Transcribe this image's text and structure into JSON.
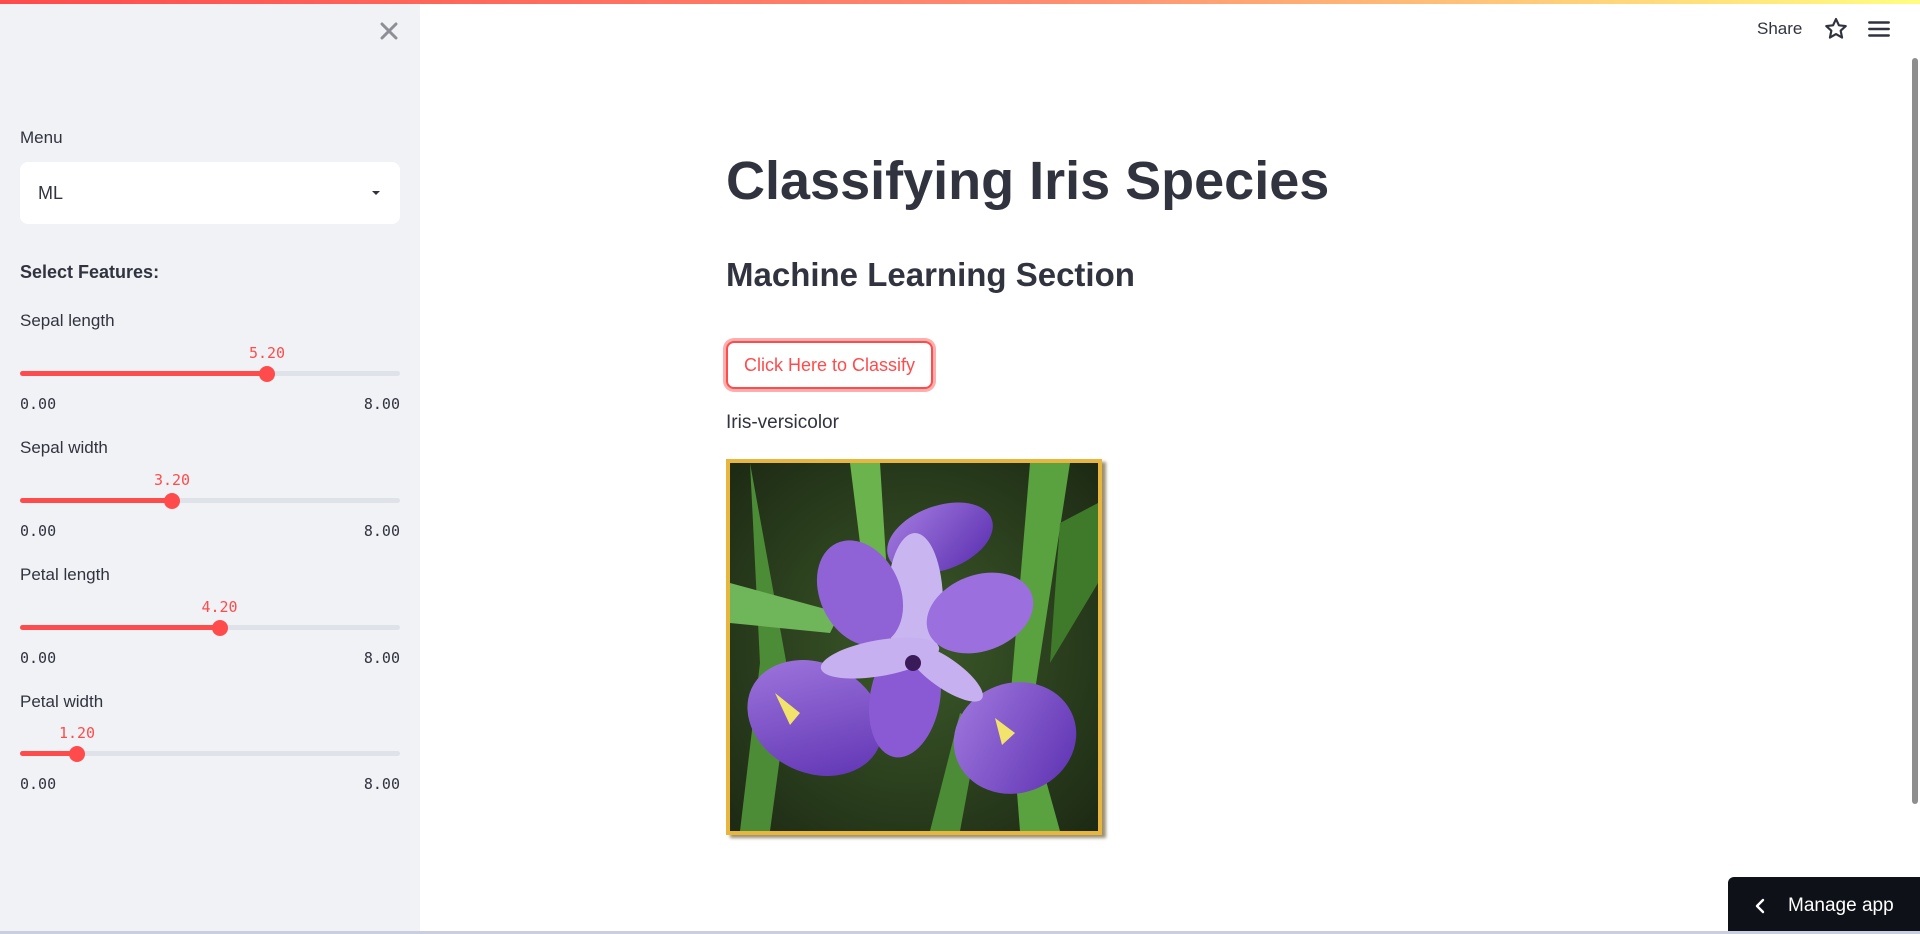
{
  "sidebar": {
    "menu_label": "Menu",
    "menu_value": "ML",
    "features_heading": "Select Features:",
    "sliders": [
      {
        "label": "Sepal length",
        "value": "5.20",
        "min": "0.00",
        "max": "8.00",
        "fraction": 0.65
      },
      {
        "label": "Sepal width",
        "value": "3.20",
        "min": "0.00",
        "max": "8.00",
        "fraction": 0.4
      },
      {
        "label": "Petal length",
        "value": "4.20",
        "min": "0.00",
        "max": "8.00",
        "fraction": 0.525
      },
      {
        "label": "Petal width",
        "value": "1.20",
        "min": "0.00",
        "max": "8.00",
        "fraction": 0.15
      }
    ]
  },
  "header": {
    "share_label": "Share"
  },
  "main": {
    "title": "Classifying Iris Species",
    "section_title": "Machine Learning Section",
    "classify_button_label": "Click Here to Classify",
    "result": "Iris-versicolor"
  },
  "footer": {
    "manage_app_label": "Manage app"
  },
  "colors": {
    "accent": "#ff4b4b",
    "sidebar_bg": "#f0f2f6",
    "text": "#31333f",
    "manage_bg": "#0e1117"
  },
  "icons": {
    "sidebar_close": "close-icon",
    "select_caret": "caret-down-icon",
    "star": "star-icon",
    "menu": "hamburger-menu-icon",
    "manage_chevron": "chevron-left-icon"
  }
}
